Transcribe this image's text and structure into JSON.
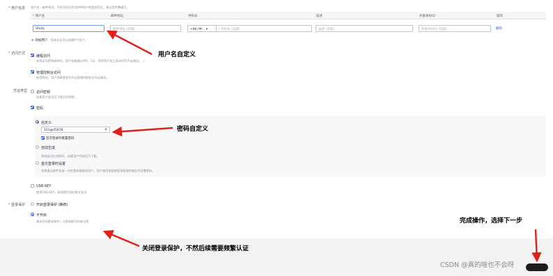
{
  "user_info": {
    "label": "用户信息",
    "hint": "用户名、邮件地址、手机号码可作为IAM用户的登录凭证，建议您完整填写。",
    "columns": [
      "用户名",
      "邮件地址",
      "手机号",
      "描述",
      "外部身份ID",
      "操作"
    ],
    "row": {
      "username": "Study",
      "email_placeholder": "邮件地址 (选填)",
      "phone_code": "+86 (中...",
      "phone_placeholder": "手机号 (选填)",
      "desc_placeholder": "描述 (选填)",
      "extid_placeholder": "外部身份ID (选填)",
      "delete": "删除"
    },
    "add_user": "添加用户",
    "add_user_hint": "您本次还可以创建9个用户。"
  },
  "access": {
    "label": "访问方式",
    "programmatic": "编程访问",
    "programmatic_hint": "启用访问密钥或密码，用户仅能通过API、CLI、SDK等开发工具访问华为云服务。",
    "console": "管理控制台访问",
    "console_hint": "启用密码，用户仅能登录华为云管理控制台访问云服务。"
  },
  "credential": {
    "label": "凭证类型",
    "ak": "访问密钥",
    "ak_hint": "创建用户成功后下载访问密钥。",
    "password": "密码",
    "custom": "自定义",
    "custom_value": "123@45678",
    "reset_first": "首次登录时重置密码",
    "auto": "自动生成",
    "auto_hint": "系统自动生成密码，创建用户完成后可下载。",
    "first_login": "首次登录时设置",
    "first_login_hint": "系统通过邮件发送一次性登录链接给用户，用户使用该链接登录管理控制台并设置密码。",
    "usbkey": "USB KEY",
    "usbkey_hint": "使用USB KEY，有效提升您的账号安全"
  },
  "login_protect": {
    "label": "登录保护",
    "enable": "开启登录保护 (推荐)",
    "disable": "不开启",
    "disable_hint": "建议开启登录保护，以提高账号的安全性"
  },
  "annotations": {
    "username": "用户名自定义",
    "password": "密码自定义",
    "protect": "关闭登录保护，不然后续需要频繁认证",
    "next": "完成操作，选择下一步"
  },
  "watermark": "CSDN @真的啥也不会呀",
  "colors": {
    "accent": "#3b63d8",
    "arrow": "#e0201b",
    "required": "#e0333c"
  }
}
